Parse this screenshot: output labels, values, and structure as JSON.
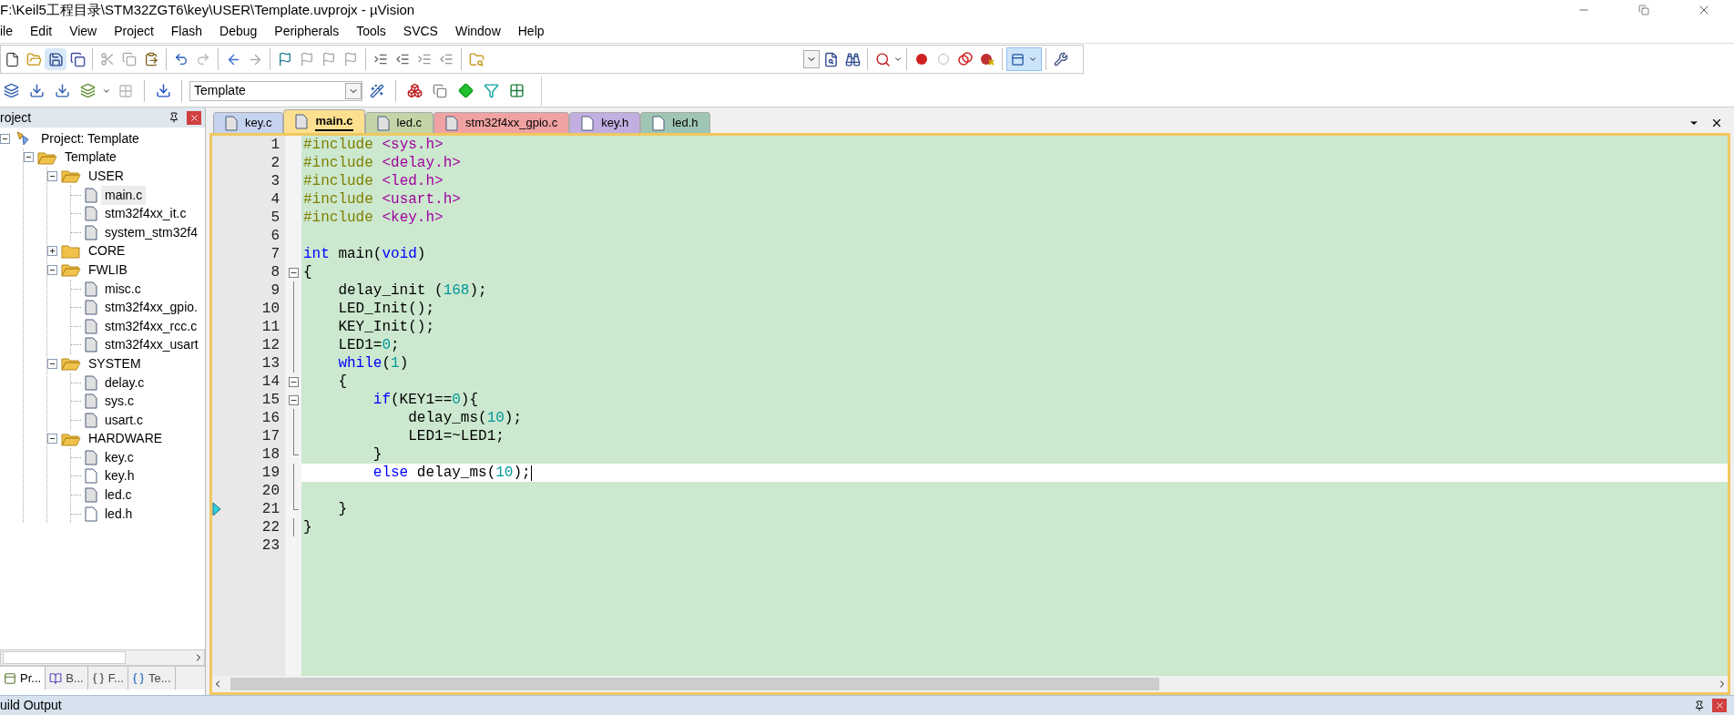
{
  "window": {
    "title": "F:\\Keil5工程目录\\STM32ZGT6\\key\\USER\\Template.uvprojx - µVision"
  },
  "menu": [
    "ile",
    "Edit",
    "View",
    "Project",
    "Flash",
    "Debug",
    "Peripherals",
    "Tools",
    "SVCS",
    "Window",
    "Help"
  ],
  "toolbar": {
    "windows_toggle": {
      "on": true
    },
    "target": "Template"
  },
  "project_panel": {
    "title": "roject",
    "tree": [
      {
        "label": "Project: Template",
        "kind": "project",
        "expanded": true,
        "children": [
          {
            "label": "Template",
            "kind": "target",
            "expanded": true,
            "children": [
              {
                "label": "USER",
                "kind": "group",
                "expanded": true,
                "children": [
                  {
                    "label": "main.c",
                    "kind": "source",
                    "selected": true
                  },
                  {
                    "label": "stm32f4xx_it.c",
                    "kind": "source",
                    "selected": false
                  },
                  {
                    "label": "system_stm32f4",
                    "kind": "source",
                    "selected": false
                  }
                ]
              },
              {
                "label": "CORE",
                "kind": "group",
                "expanded": false
              },
              {
                "label": "FWLIB",
                "kind": "group",
                "expanded": true,
                "children": [
                  {
                    "label": "misc.c",
                    "kind": "source",
                    "selected": false
                  },
                  {
                    "label": "stm32f4xx_gpio.",
                    "kind": "source",
                    "selected": false
                  },
                  {
                    "label": "stm32f4xx_rcc.c",
                    "kind": "source",
                    "selected": false
                  },
                  {
                    "label": "stm32f4xx_usart",
                    "kind": "source",
                    "selected": false
                  }
                ]
              },
              {
                "label": "SYSTEM",
                "kind": "group",
                "expanded": true,
                "children": [
                  {
                    "label": "delay.c",
                    "kind": "source",
                    "selected": false
                  },
                  {
                    "label": "sys.c",
                    "kind": "source",
                    "selected": false
                  },
                  {
                    "label": "usart.c",
                    "kind": "source",
                    "selected": false
                  }
                ]
              },
              {
                "label": "HARDWARE",
                "kind": "group",
                "expanded": true,
                "children": [
                  {
                    "label": "key.c",
                    "kind": "source",
                    "selected": false
                  },
                  {
                    "label": "key.h",
                    "kind": "header",
                    "selected": false
                  },
                  {
                    "label": "led.c",
                    "kind": "source",
                    "selected": false
                  },
                  {
                    "label": "led.h",
                    "kind": "header",
                    "selected": false
                  }
                ]
              }
            ]
          }
        ]
      }
    ],
    "bottom_tabs": [
      {
        "label": "Pr...",
        "kind": "project",
        "selected": true
      },
      {
        "label": "B...",
        "kind": "books",
        "selected": false
      },
      {
        "label": "F...",
        "kind": "functions",
        "selected": false
      },
      {
        "label": "Te...",
        "kind": "templates",
        "selected": false
      }
    ]
  },
  "editor_tabs": [
    {
      "label": "key.c",
      "kind": "source",
      "color": "#c5d3ef",
      "selected": false
    },
    {
      "label": "main.c",
      "kind": "source",
      "color": "#fde08f",
      "selected": true
    },
    {
      "label": "led.c",
      "kind": "source",
      "color": "#c4d4a6",
      "selected": false
    },
    {
      "label": "stm32f4xx_gpio.c",
      "kind": "source",
      "color": "#f0a2a2",
      "selected": false
    },
    {
      "label": "key.h",
      "kind": "header",
      "color": "#c2aee0",
      "selected": false
    },
    {
      "label": "led.h",
      "kind": "header",
      "color": "#9fc6b4",
      "selected": false
    }
  ],
  "code": [
    {
      "number": "1",
      "kind": "plain",
      "tokens": [
        {
          "kind": "pp",
          "text": "#include "
        },
        {
          "kind": "str",
          "text": "<sys.h>"
        }
      ]
    },
    {
      "number": "2",
      "kind": "plain",
      "tokens": [
        {
          "kind": "pp",
          "text": "#include "
        },
        {
          "kind": "str",
          "text": "<delay.h>"
        }
      ]
    },
    {
      "number": "3",
      "kind": "plain",
      "tokens": [
        {
          "kind": "pp",
          "text": "#include "
        },
        {
          "kind": "str",
          "text": "<led.h>"
        }
      ]
    },
    {
      "number": "4",
      "kind": "plain",
      "tokens": [
        {
          "kind": "pp",
          "text": "#include "
        },
        {
          "kind": "str",
          "text": "<usart.h>"
        }
      ]
    },
    {
      "number": "5",
      "kind": "plain",
      "tokens": [
        {
          "kind": "pp",
          "text": "#include "
        },
        {
          "kind": "str",
          "text": "<key.h>"
        }
      ]
    },
    {
      "number": "6",
      "kind": "plain"
    },
    {
      "number": "7",
      "kind": "plain",
      "tokens": [
        {
          "kind": "kw",
          "text": "int"
        },
        {
          "kind": "plain",
          "text": " main("
        },
        {
          "kind": "kw",
          "text": "void"
        },
        {
          "kind": "plain",
          "text": ")"
        }
      ]
    },
    {
      "number": "8",
      "kind": "fold_start",
      "tokens": [
        {
          "kind": "plain",
          "text": "{"
        }
      ]
    },
    {
      "number": "9",
      "kind": "fold_line",
      "tokens": [
        {
          "kind": "plain",
          "text": "    delay_init ("
        },
        {
          "kind": "num",
          "text": "168"
        },
        {
          "kind": "plain",
          "text": ");"
        }
      ]
    },
    {
      "number": "10",
      "kind": "fold_line",
      "tokens": [
        {
          "kind": "plain",
          "text": "    LED_Init();"
        }
      ]
    },
    {
      "number": "11",
      "kind": "fold_line",
      "tokens": [
        {
          "kind": "plain",
          "text": "    KEY_Init();"
        }
      ]
    },
    {
      "number": "12",
      "kind": "fold_line",
      "tokens": [
        {
          "kind": "plain",
          "text": "    LED1="
        },
        {
          "kind": "num",
          "text": "0"
        },
        {
          "kind": "plain",
          "text": ";"
        }
      ]
    },
    {
      "number": "13",
      "kind": "fold_line",
      "tokens": [
        {
          "kind": "kw",
          "text": "    while"
        },
        {
          "kind": "plain",
          "text": "("
        },
        {
          "kind": "num",
          "text": "1"
        },
        {
          "kind": "plain",
          "text": ")"
        }
      ]
    },
    {
      "number": "14",
      "kind": "fold_start",
      "tokens": [
        {
          "kind": "plain",
          "text": "    {"
        }
      ]
    },
    {
      "number": "15",
      "kind": "fold_start",
      "tokens": [
        {
          "kind": "kw",
          "text": "        if"
        },
        {
          "kind": "plain",
          "text": "(KEY1=="
        },
        {
          "kind": "num",
          "text": "0"
        },
        {
          "kind": "plain",
          "text": "){"
        }
      ]
    },
    {
      "number": "16",
      "kind": "fold_line",
      "tokens": [
        {
          "kind": "plain",
          "text": "            delay_ms("
        },
        {
          "kind": "num",
          "text": "10"
        },
        {
          "kind": "plain",
          "text": ");"
        }
      ]
    },
    {
      "number": "17",
      "kind": "fold_line",
      "tokens": [
        {
          "kind": "plain",
          "text": "            LED1=~LED1;"
        }
      ]
    },
    {
      "number": "18",
      "kind": "fold_end",
      "tokens": [
        {
          "kind": "plain",
          "text": "        }"
        }
      ]
    },
    {
      "number": "19",
      "kind": "fold_line",
      "current": true,
      "tokens": [
        {
          "kind": "kw",
          "text": "        else"
        },
        {
          "kind": "plain",
          "text": " delay_ms("
        },
        {
          "kind": "num",
          "text": "10"
        },
        {
          "kind": "plain",
          "text": ");"
        }
      ]
    },
    {
      "number": "20",
      "kind": "fold_line"
    },
    {
      "number": "21",
      "kind": "fold_end",
      "marker": true,
      "tokens": [
        {
          "kind": "plain",
          "text": "    }"
        }
      ]
    },
    {
      "number": "22",
      "kind": "fold_line",
      "tokens": [
        {
          "kind": "plain",
          "text": "}"
        }
      ]
    },
    {
      "number": "23",
      "kind": "plain"
    }
  ],
  "output_panel": {
    "title": "uild Output"
  }
}
